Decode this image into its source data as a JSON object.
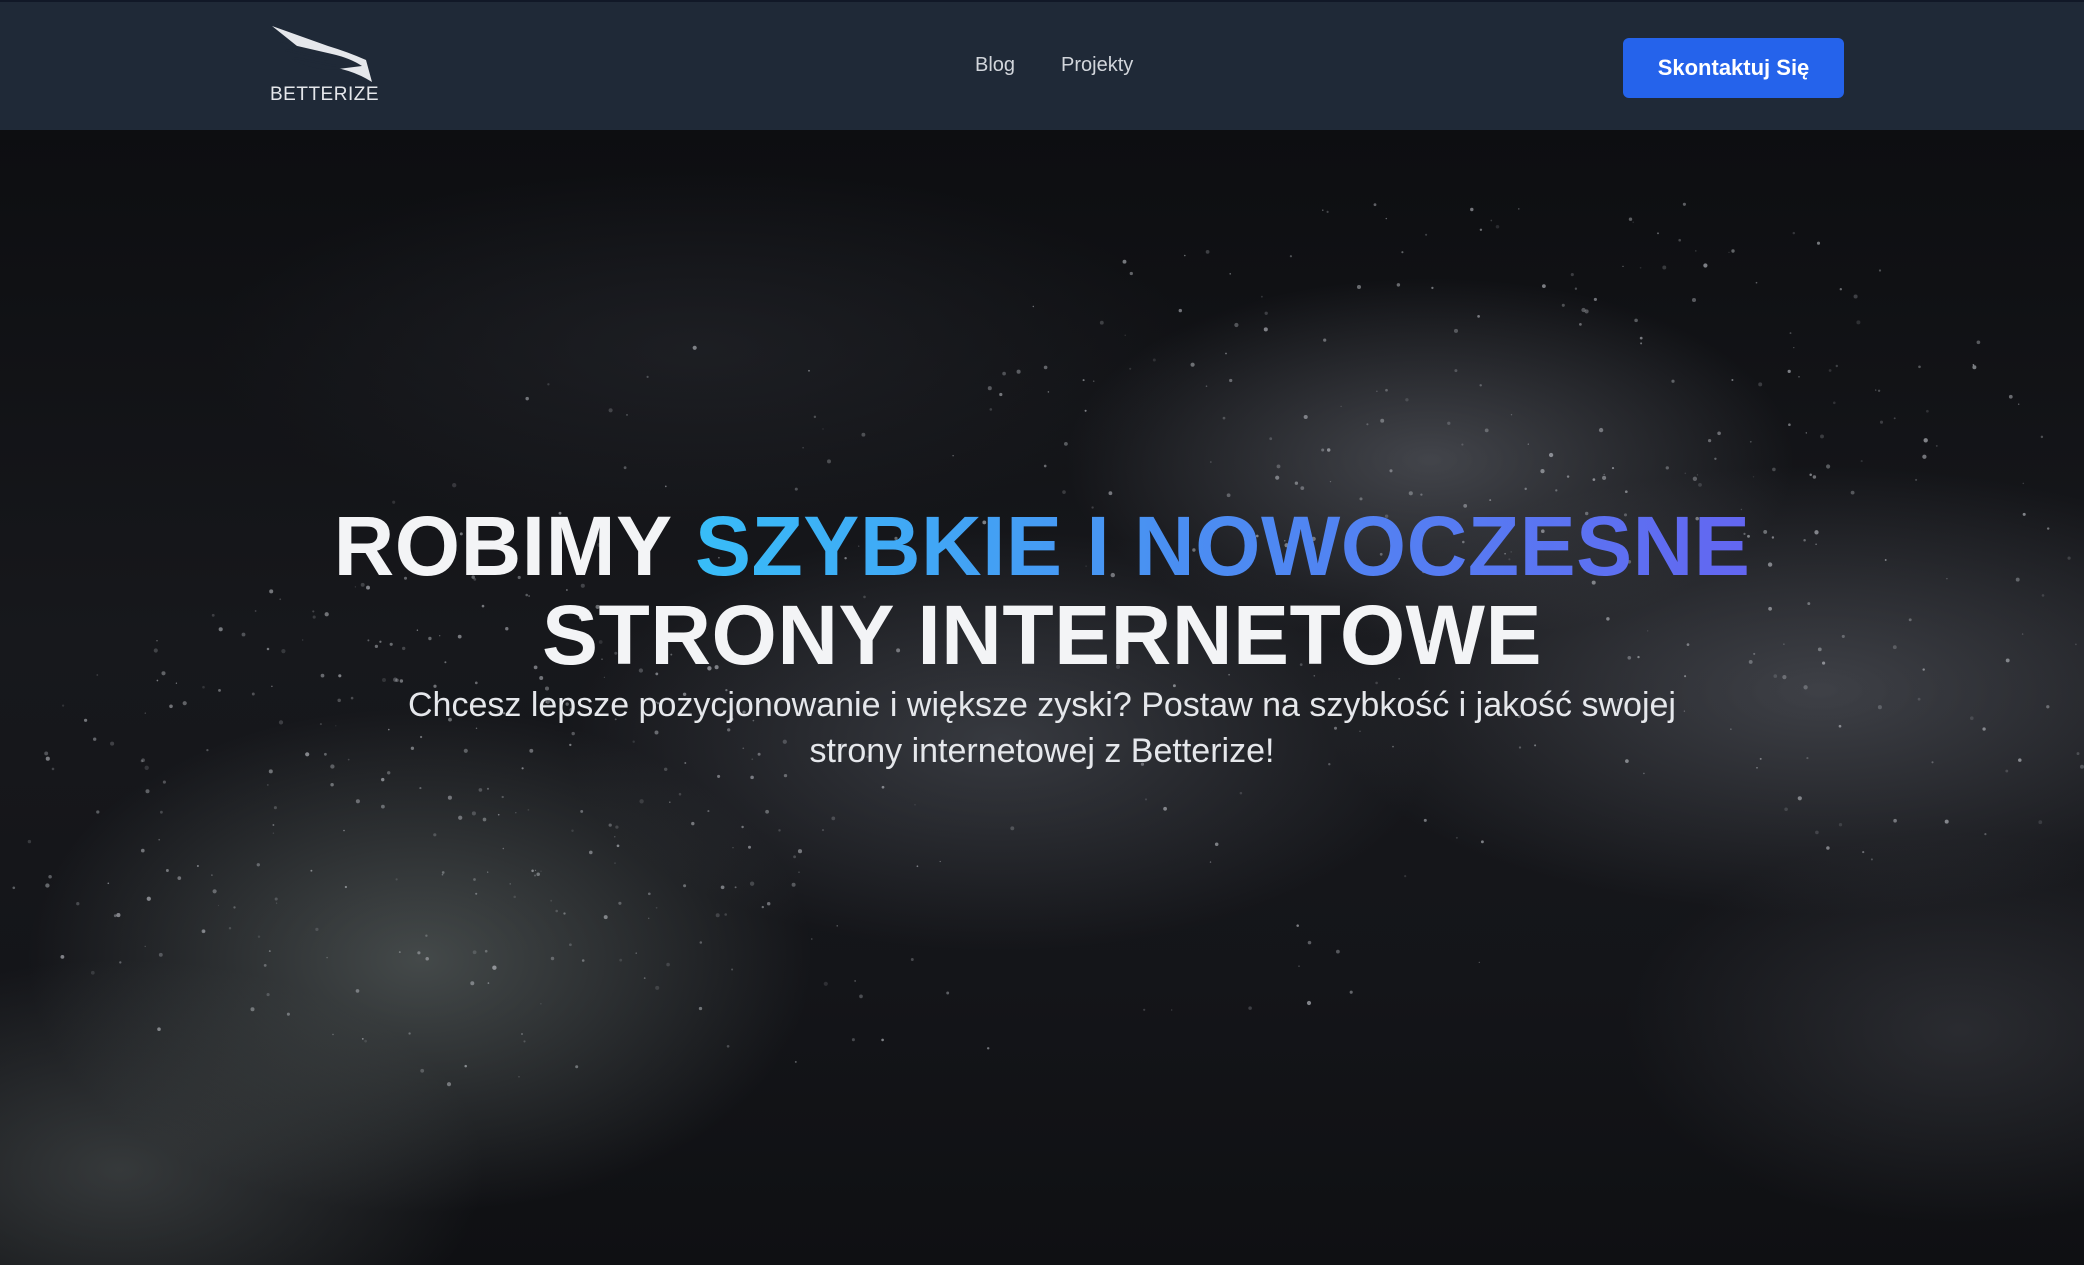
{
  "header": {
    "logo_text": "BETTERIZE",
    "nav": [
      {
        "label": "Blog"
      },
      {
        "label": "Projekty"
      }
    ],
    "cta_label": "Skontaktuj Się"
  },
  "hero": {
    "title_prefix": "ROBIMY",
    "title_highlight": "SZYBKIE I NOWOCZESNE",
    "title_line2": "STRONY INTERNETOWE",
    "subtitle": "Chcesz lepsze pozycjonowanie i większe zyski? Postaw na szybkość i jakość swojej strony internetowej z Betterize!"
  },
  "colors": {
    "navbar_bg": "#1f2937",
    "cta_bg": "#2563eb",
    "highlight_start": "#38bdf8",
    "highlight_end": "#6366f1",
    "hero_bg": "#0e0f12"
  },
  "icons": {
    "logo": "wing-logo-icon"
  }
}
